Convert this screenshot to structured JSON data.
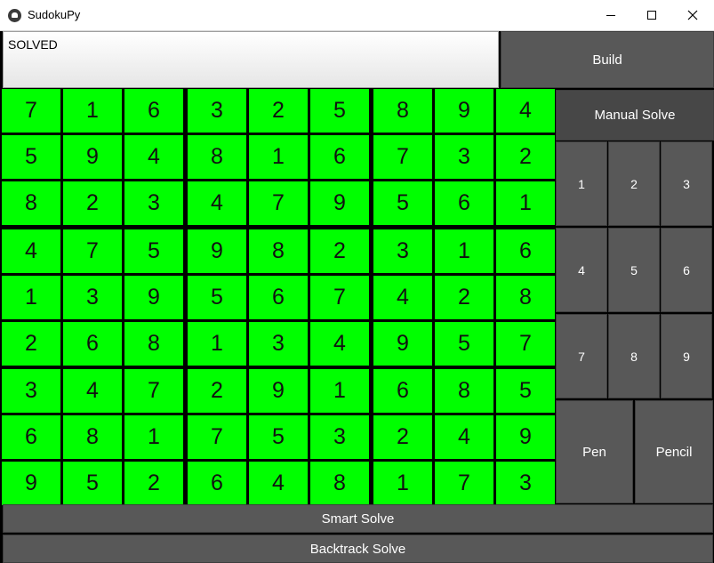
{
  "window": {
    "title": "SudokuPy",
    "icons": [
      "app-icon",
      "minimize-icon",
      "maximize-icon",
      "close-icon"
    ]
  },
  "status": {
    "text": "SOLVED"
  },
  "buttons": {
    "build": "Build",
    "manual_solve": "Manual Solve",
    "numbers": [
      "1",
      "2",
      "3",
      "4",
      "5",
      "6",
      "7",
      "8",
      "9"
    ],
    "pen": "Pen",
    "pencil": "Pencil",
    "smart_solve": "Smart Solve",
    "backtrack_solve": "Backtrack Solve"
  },
  "board": {
    "cell_color": "#00ff00",
    "grid": [
      [
        "7",
        "1",
        "6",
        "3",
        "2",
        "5",
        "8",
        "9",
        "4"
      ],
      [
        "5",
        "9",
        "4",
        "8",
        "1",
        "6",
        "7",
        "3",
        "2"
      ],
      [
        "8",
        "2",
        "3",
        "4",
        "7",
        "9",
        "5",
        "6",
        "1"
      ],
      [
        "4",
        "7",
        "5",
        "9",
        "8",
        "2",
        "3",
        "1",
        "6"
      ],
      [
        "1",
        "3",
        "9",
        "5",
        "6",
        "7",
        "4",
        "2",
        "8"
      ],
      [
        "2",
        "6",
        "8",
        "1",
        "3",
        "4",
        "9",
        "5",
        "7"
      ],
      [
        "3",
        "4",
        "7",
        "2",
        "9",
        "1",
        "6",
        "8",
        "5"
      ],
      [
        "6",
        "8",
        "1",
        "7",
        "5",
        "3",
        "2",
        "4",
        "9"
      ],
      [
        "9",
        "5",
        "2",
        "6",
        "4",
        "8",
        "1",
        "7",
        "3"
      ]
    ]
  },
  "colors": {
    "button_bg": "#585858",
    "highlight_button_bg": "#474747",
    "solved_cell": "#00ff00"
  }
}
